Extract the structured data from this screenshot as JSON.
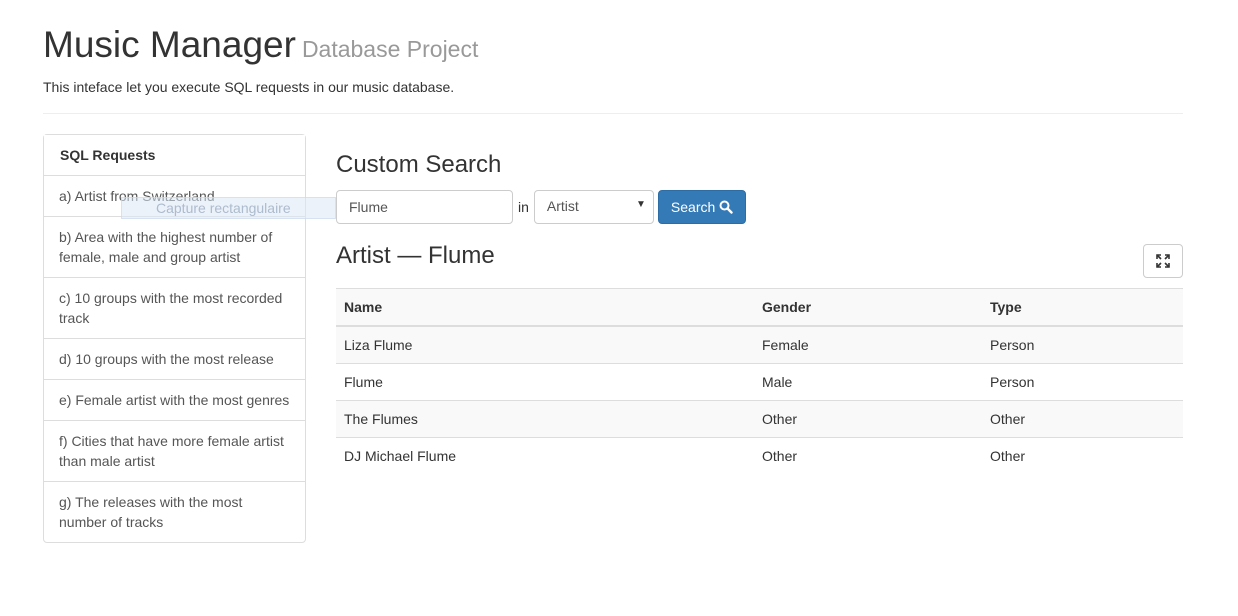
{
  "header": {
    "title": "Music Manager",
    "title_small": "Database Project",
    "subtitle": "This inteface let you execute SQL requests in our music database."
  },
  "sidebar": {
    "heading": "SQL Requests",
    "items": [
      {
        "label": "a) Artist from Switzerland"
      },
      {
        "label": "b) Area with the highest number of female, male and group artist"
      },
      {
        "label": "c) 10 groups with the most recorded track"
      },
      {
        "label": "d) 10 groups with the most release"
      },
      {
        "label": "e) Female artist with the most genres"
      },
      {
        "label": "f) Cities that have more female artist than male artist"
      },
      {
        "label": "g) The releases with the most number of tracks"
      }
    ]
  },
  "overlay": {
    "text": "Capture rectangulaire"
  },
  "search": {
    "title": "Custom Search",
    "input_value": "Flume",
    "in_label": "in",
    "select_value": "Artist",
    "button_label": "Search",
    "icons": {
      "search": "search-icon",
      "expand": "expand-icon",
      "caret": "caret-down-icon"
    }
  },
  "results": {
    "title": "Artist — Flume",
    "columns": [
      "Name",
      "Gender",
      "Type"
    ],
    "rows": [
      [
        "Liza Flume",
        "Female",
        "Person"
      ],
      [
        "Flume",
        "Male",
        "Person"
      ],
      [
        "The Flumes",
        "Other",
        "Other"
      ],
      [
        "DJ Michael Flume",
        "Other",
        "Other"
      ]
    ]
  },
  "colors": {
    "primary": "#337ab7",
    "border": "#dddddd",
    "stripe": "#f9f9f9"
  }
}
